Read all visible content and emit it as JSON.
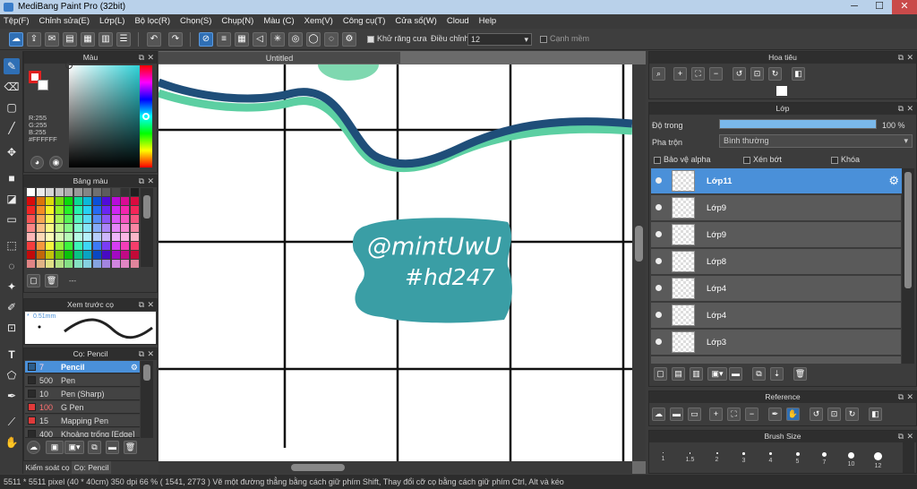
{
  "app": {
    "title": "MediBang Paint Pro (32bit)"
  },
  "menu": [
    "Tệp(F)",
    "Chỉnh sửa(E)",
    "Lớp(L)",
    "Bộ lọc(R)",
    "Chọn(S)",
    "Chụp(N)",
    "Màu (C)",
    "Xem(V)",
    "Công cụ(T)",
    "Cửa sổ(W)",
    "Cloud",
    "Help"
  ],
  "toolbar": {
    "antialias_label": "Khử răng cưa",
    "antialias_checked": true,
    "correction_label": "Điều chỉnh",
    "correction_value": "12",
    "edge_label": "Cạnh mềm",
    "edge_checked": false
  },
  "color_panel": {
    "title": "Màu",
    "r": "R:255",
    "g": "G:255",
    "b": "B:255",
    "hex": "#FFFFFF"
  },
  "palette_panel": {
    "title": "Bảng màu",
    "more": "---"
  },
  "preview_panel": {
    "title": "Xem trước cọ",
    "size": "0.51mm"
  },
  "brush_panel": {
    "title": "Cọ: Pencil",
    "brushes": [
      {
        "size": "7",
        "name": "Pencil",
        "color": "#2c5d8a"
      },
      {
        "size": "500",
        "name": "Pen",
        "color": "#2a2a2a"
      },
      {
        "size": "10",
        "name": "Pen (Sharp)",
        "color": "#2a2a2a"
      },
      {
        "size": "100",
        "name": "G Pen",
        "color": "#e03a3a"
      },
      {
        "size": "15",
        "name": "Mapping Pen",
        "color": "#e03a3a"
      },
      {
        "size": "400",
        "name": "Khoảng trống [Edge]",
        "color": "#2a2a2a"
      }
    ]
  },
  "bottom_tabs": [
    "Kiểm soát cọ",
    "Cọ: Pencil"
  ],
  "document": {
    "tab": "Untitled",
    "text_line1": "@mintUwU",
    "text_line2": "#hd247"
  },
  "navigator": {
    "title": "Hoa tiêu"
  },
  "layer_panel": {
    "title": "Lớp",
    "opacity_label": "Độ trong",
    "opacity_value": "100 %",
    "opacity_fraction": 1.0,
    "blend_label": "Pha trộn",
    "blend_value": "Bình thường",
    "protect_alpha": "Bảo vệ alpha",
    "clipping": "Xén bớt",
    "lock": "Khóa",
    "layers": [
      "Lớp11",
      "Lớp9",
      "Lớp9",
      "Lớp8",
      "Lớp4",
      "Lớp4",
      "Lớp3"
    ]
  },
  "reference_panel": {
    "title": "Reference"
  },
  "brush_size_panel": {
    "title": "Brush Size",
    "sizes": [
      "1",
      "1.5",
      "2",
      "3",
      "4",
      "5",
      "7",
      "10",
      "12"
    ]
  },
  "status": {
    "text": "5511 * 5511 pixel  (40 * 40cm)  350 dpi  66 %  ( 1541, 2773 )  Vẽ một đường thẳng bằng cách giữ phím Shift, Thay đổi cỡ cọ bằng cách giữ phím Ctrl, Alt và kéo"
  },
  "colors": {
    "accent": "#4a90d9",
    "stroke_dark": "#1f4e79",
    "stroke_light": "#5ccfa2",
    "blob": "#3a9ea5"
  }
}
